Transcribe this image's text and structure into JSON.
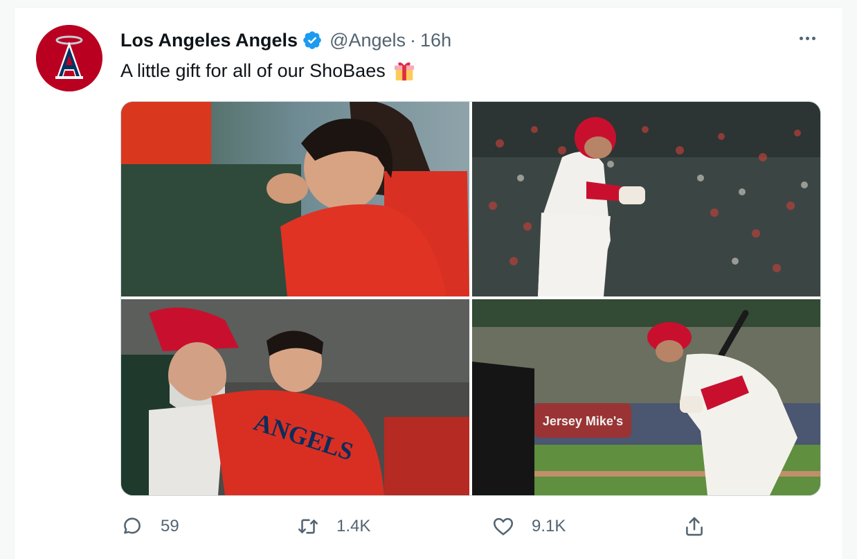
{
  "tweet": {
    "author_name": "Los Angeles Angels",
    "handle": "@Angels",
    "separator": "·",
    "time": "16h",
    "text": "A little gift for all of our ShoBaes",
    "emoji": "gift",
    "verified": true
  },
  "media": {
    "photos": [
      {
        "name": "photo-dugout-smile"
      },
      {
        "name": "photo-home-run-trot"
      },
      {
        "name": "photo-angels-jersey"
      },
      {
        "name": "photo-batting-stance"
      }
    ],
    "jersey_text": "ANGELS",
    "board_text": "Jersey Mike's"
  },
  "actions": {
    "reply_count": "59",
    "retweet_count": "1.4K",
    "like_count": "9.1K"
  },
  "icons": {
    "avatar": "angels-logo-icon",
    "verified": "verified-badge-icon",
    "more": "more-options-icon",
    "reply": "reply-icon",
    "retweet": "retweet-icon",
    "like": "heart-icon",
    "share": "share-icon"
  },
  "colors": {
    "brand_red": "#ba0021",
    "verified_blue": "#1d9bf0",
    "secondary_text": "#536471"
  }
}
